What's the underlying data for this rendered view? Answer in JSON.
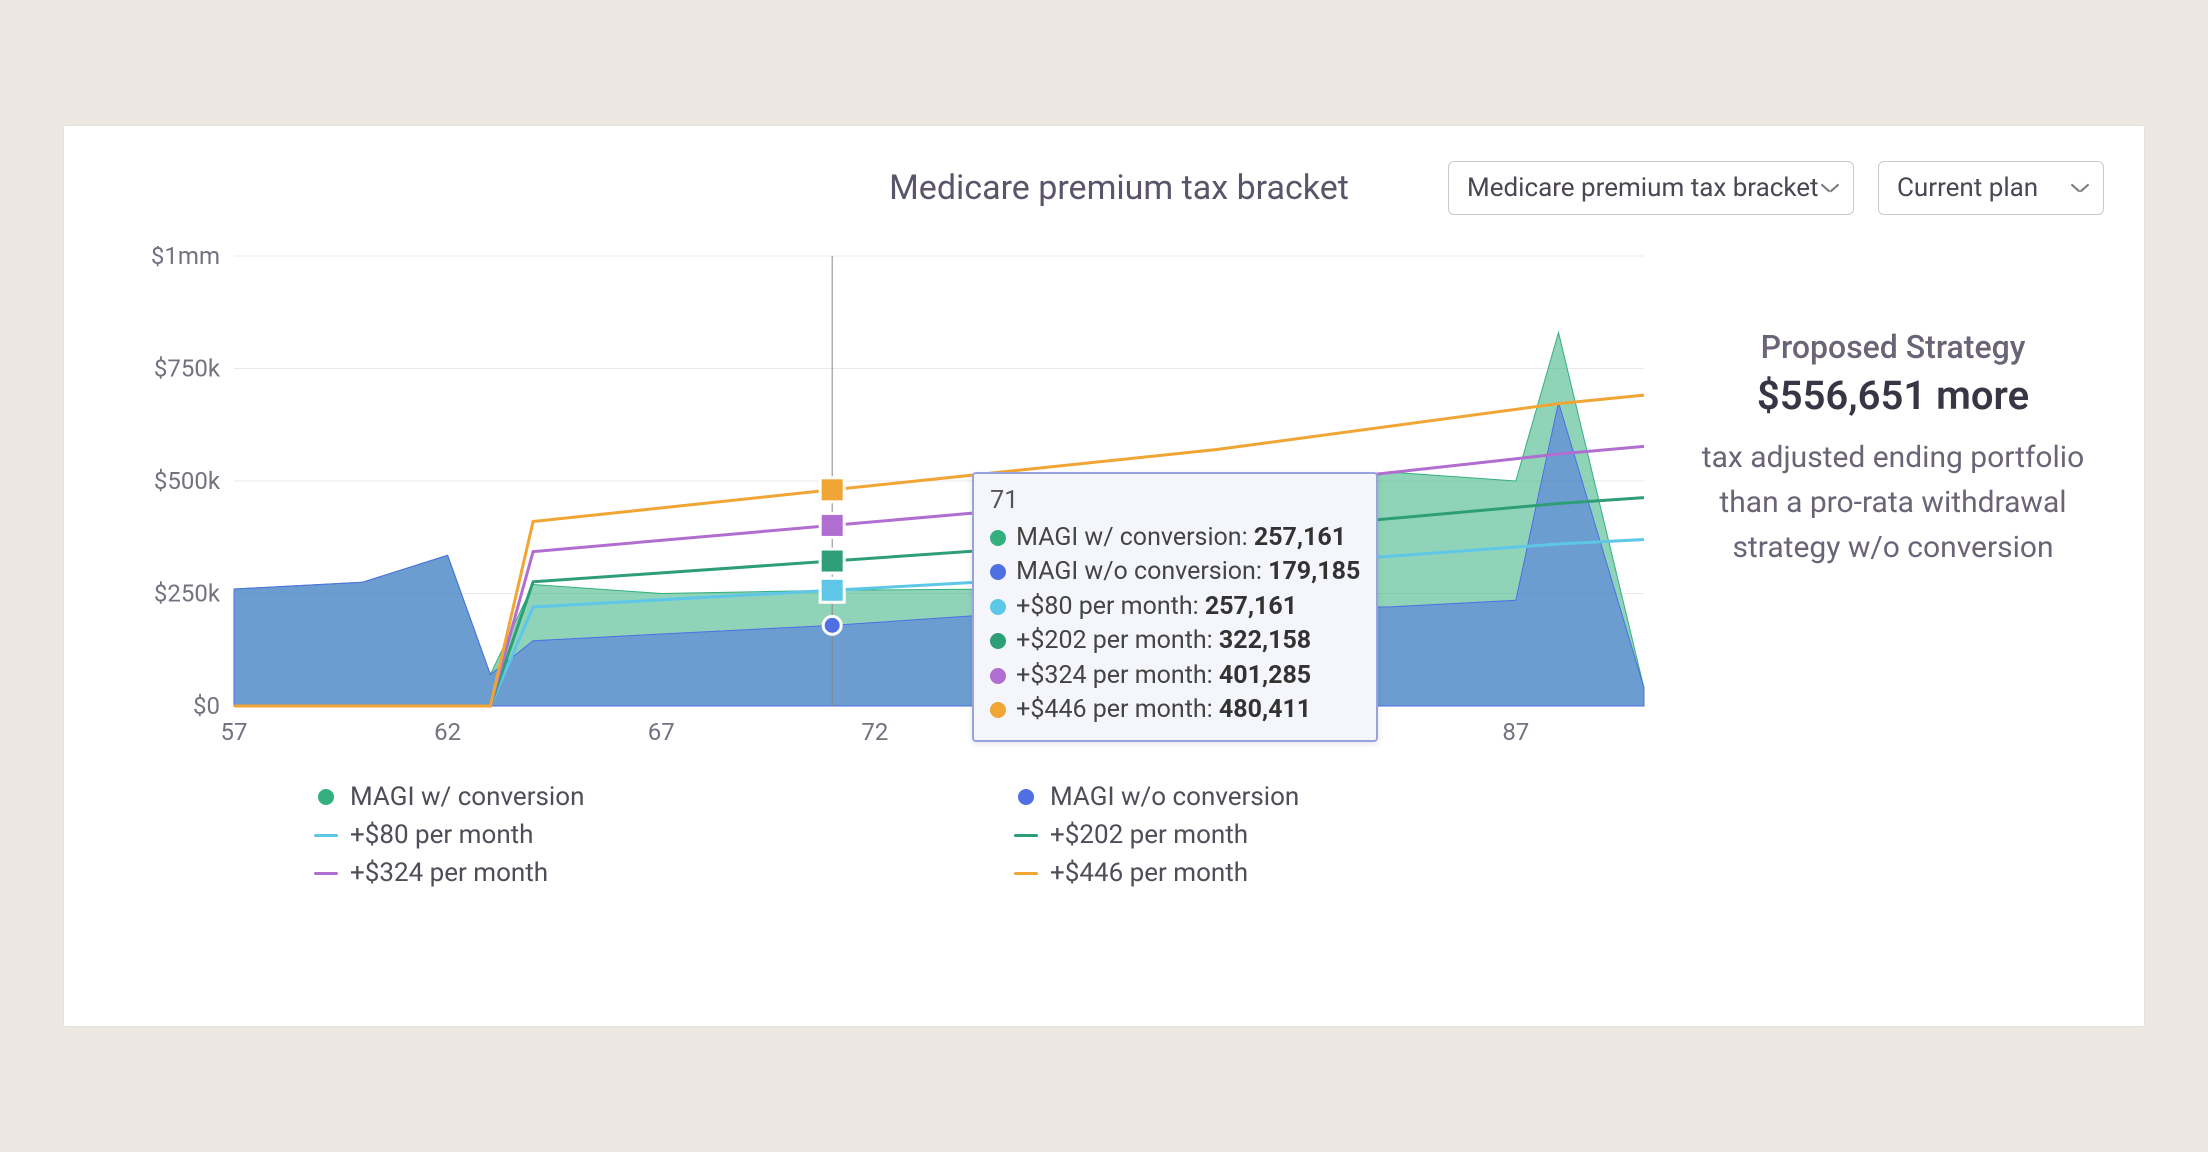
{
  "header": {
    "title": "Medicare premium tax bracket",
    "select1": {
      "label": "Medicare premium tax bracket"
    },
    "select2": {
      "label": "Current plan"
    }
  },
  "summary": {
    "heading": "Proposed Strategy",
    "amount": "$556,651 more",
    "caption": "tax adjusted ending portfolio than a pro-rata withdrawal strategy w/o conversion"
  },
  "tooltip": {
    "age": "71",
    "rows": [
      {
        "label": "MAGI w/ conversion:",
        "value": "257,161",
        "color": "#33b07e"
      },
      {
        "label": "MAGI w/o conversion:",
        "value": "179,185",
        "color": "#4f6fe3"
      },
      {
        "label": "+$80 per month:",
        "value": "257,161",
        "color": "#5ec7e8"
      },
      {
        "label": "+$202 per month:",
        "value": "322,158",
        "color": "#2e9e77"
      },
      {
        "label": "+$324 per month:",
        "value": "401,285",
        "color": "#b06fd0"
      },
      {
        "label": "+$446 per month:",
        "value": "480,411",
        "color": "#f0a534"
      }
    ]
  },
  "legend": [
    {
      "kind": "dot",
      "color": "#33b07e",
      "label": "MAGI w/ conversion"
    },
    {
      "kind": "dot",
      "color": "#4f6fe3",
      "label": "MAGI w/o conversion"
    },
    {
      "kind": "line",
      "color": "#5ec7e8",
      "label": "+$80 per month"
    },
    {
      "kind": "line",
      "color": "#2e9e77",
      "label": "+$202 per month"
    },
    {
      "kind": "line",
      "color": "#b06fd0",
      "label": "+$324 per month"
    },
    {
      "kind": "line",
      "color": "#f0a534",
      "label": "+$446 per month"
    }
  ],
  "chart_data": {
    "type": "area",
    "title": "Medicare premium tax bracket",
    "xlabel": "",
    "ylabel": "",
    "xlim": [
      57,
      90
    ],
    "ylim": [
      0,
      1000000
    ],
    "y_ticks": [
      0,
      250000,
      500000,
      750000,
      1000000
    ],
    "y_tick_labels": [
      "$0",
      "$250k",
      "$500k",
      "$750k",
      "$1mm"
    ],
    "x_ticks": [
      57,
      62,
      67,
      72,
      77,
      82,
      87
    ],
    "hover_x": 71,
    "colors": {
      "magi_conv": "#33b07e",
      "magi_noconv": "#4f6fe3",
      "plus80": "#5ec7e8",
      "plus202": "#2e9e77",
      "plus324": "#b06fd0",
      "plus446": "#f0a534"
    },
    "series": [
      {
        "name": "MAGI w/ conversion",
        "kind": "area",
        "color": "#33b07e",
        "x": [
          57,
          60,
          62,
          63,
          64,
          67,
          71,
          75,
          77,
          80,
          84,
          87,
          88,
          90
        ],
        "values": [
          260000,
          275000,
          335000,
          70000,
          270000,
          250000,
          257161,
          260000,
          260000,
          390000,
          520000,
          500000,
          830000,
          40000
        ]
      },
      {
        "name": "MAGI w/o conversion",
        "kind": "area",
        "color": "#4f6fe3",
        "x": [
          57,
          60,
          62,
          63,
          64,
          67,
          71,
          75,
          76,
          77,
          78,
          80,
          84,
          87,
          88,
          90
        ],
        "values": [
          260000,
          275000,
          335000,
          70000,
          145000,
          160000,
          179185,
          205000,
          270000,
          260000,
          300000,
          220000,
          220000,
          235000,
          675000,
          40000
        ]
      },
      {
        "name": "+$80 per month",
        "kind": "line",
        "color": "#5ec7e8",
        "x": [
          57,
          58,
          63,
          64,
          71,
          80,
          88,
          90
        ],
        "values": [
          0,
          0,
          0,
          220000,
          257161,
          305000,
          360000,
          370000
        ]
      },
      {
        "name": "+$202 per month",
        "kind": "line",
        "color": "#2e9e77",
        "x": [
          57,
          58,
          63,
          64,
          71,
          80,
          88,
          90
        ],
        "values": [
          0,
          0,
          0,
          276000,
          322158,
          382000,
          450000,
          463000
        ]
      },
      {
        "name": "+$324 per month",
        "kind": "line",
        "color": "#b06fd0",
        "x": [
          57,
          58,
          63,
          64,
          71,
          80,
          88,
          90
        ],
        "values": [
          0,
          0,
          0,
          343000,
          401285,
          476000,
          560000,
          577000
        ]
      },
      {
        "name": "+$446 per month",
        "kind": "line",
        "color": "#f0a534",
        "x": [
          57,
          58,
          63,
          64,
          71,
          80,
          88,
          90
        ],
        "values": [
          0,
          0,
          0,
          410000,
          480411,
          570000,
          672000,
          691000
        ]
      }
    ]
  }
}
